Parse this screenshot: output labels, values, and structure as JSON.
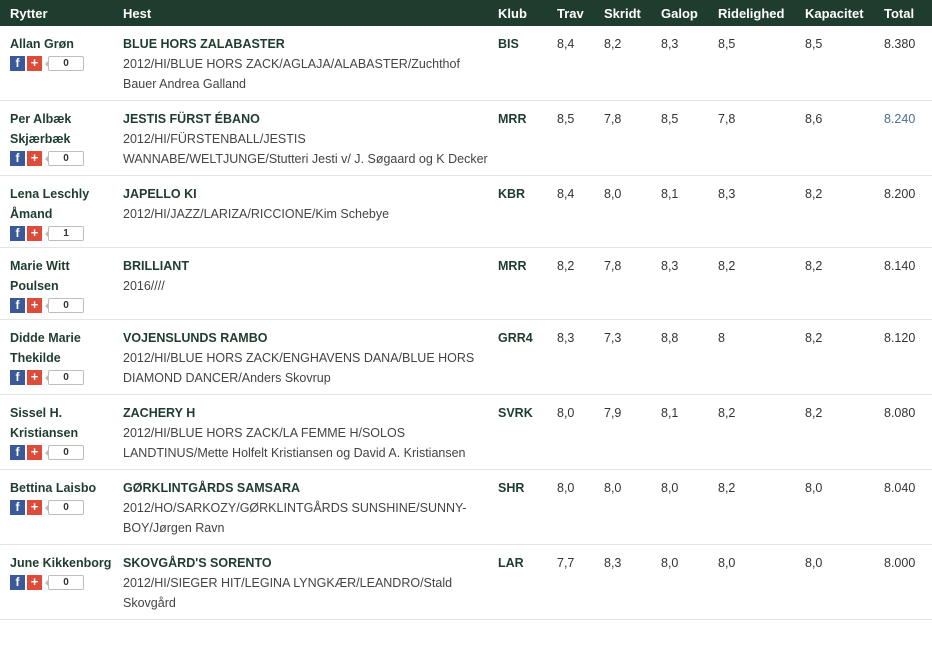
{
  "table": {
    "headers": [
      "Rytter",
      "Hest",
      "Klub",
      "Trav",
      "Skridt",
      "Galop",
      "Ridelighed",
      "Kapacitet",
      "Total"
    ],
    "rows": [
      {
        "rider": "Allan Grøn",
        "horse": "BLUE HORS ZALABASTER",
        "info": "2012/HI/BLUE HORS ZACK/AGLAJA/ALABASTER/Zuchthof Bauer Andrea Galland",
        "club": "BIS",
        "trav": "8,4",
        "skridt": "8,2",
        "galop": "8,3",
        "ridelighed": "8,5",
        "kapacitet": "8,5",
        "total": "8.380",
        "count": "0"
      },
      {
        "rider": "Per Albæk Skjærbæk",
        "horse": "JESTIS FÜRST ÉBANO",
        "info": "2012/HI/FÜRSTENBALL/JESTIS WANNABE/WELTJUNGE/Stutteri Jesti v/ J. Søgaard og K Decker",
        "club": "MRR",
        "trav": "8,5",
        "skridt": "7,8",
        "galop": "8,5",
        "ridelighed": "7,8",
        "kapacitet": "8,6",
        "total": "8.240",
        "count": "0"
      },
      {
        "rider": "Lena Leschly Åmand",
        "horse": "JAPELLO KI",
        "info": "2012/HI/JAZZ/LARIZA/RICCIONE/Kim Schebye",
        "club": "KBR",
        "trav": "8,4",
        "skridt": "8,0",
        "galop": "8,1",
        "ridelighed": "8,3",
        "kapacitet": "8,2",
        "total": "8.200",
        "count": "1"
      },
      {
        "rider": "Marie Witt Poulsen",
        "horse": "BRILLIANT",
        "info": "2016////",
        "club": "MRR",
        "trav": "8,2",
        "skridt": "7,8",
        "galop": "8,3",
        "ridelighed": "8,2",
        "kapacitet": "8,2",
        "total": "8.140",
        "count": "0"
      },
      {
        "rider": "Didde Marie Thekilde",
        "horse": "VOJENSLUNDS RAMBO",
        "info": "2012/HI/BLUE HORS ZACK/ENGHAVENS DANA/BLUE HORS DIAMOND DANCER/Anders Skovrup",
        "club": "GRR4",
        "trav": "8,3",
        "skridt": "7,3",
        "galop": "8,8",
        "ridelighed": "8",
        "kapacitet": "8,2",
        "total": "8.120",
        "count": "0"
      },
      {
        "rider": "Sissel H. Kristiansen",
        "horse": "ZACHERY H",
        "info": "2012/HI/BLUE HORS ZACK/LA FEMME H/SOLOS LANDTINUS/Mette Holfelt Kristiansen og David A. Kristiansen",
        "club": "SVRK",
        "trav": "8,0",
        "skridt": "7,9",
        "galop": "8,1",
        "ridelighed": "8,2",
        "kapacitet": "8,2",
        "total": "8.080",
        "count": "0"
      },
      {
        "rider": "Bettina Laisbo",
        "horse": "GØRKLINTGÅRDS SAMSARA",
        "info": "2012/HO/SARKOZY/GØRKLINTGÅRDS SUNSHINE/SUNNY-BOY/Jørgen Ravn",
        "club": "SHR",
        "trav": "8,0",
        "skridt": "8,0",
        "galop": "8,0",
        "ridelighed": "8,2",
        "kapacitet": "8,0",
        "total": "8.040",
        "count": "0"
      },
      {
        "rider": "June Kikkenborg",
        "horse": "SKOVGÅRD'S SORENTO",
        "info": "2012/HI/SIEGER HIT/LEGINA LYNGKÆR/LEANDRO/Stald Skovgård",
        "club": "LAR",
        "trav": "7,7",
        "skridt": "8,3",
        "galop": "8,0",
        "ridelighed": "8,0",
        "kapacitet": "8,0",
        "total": "8.000",
        "count": "0"
      }
    ]
  },
  "social": {
    "facebook_glyph": "f",
    "google_glyph": "+"
  },
  "colors": {
    "header_bg": "#1f3d2f",
    "accent_text": "#1f3d2f",
    "facebook": "#3b5998",
    "google": "#dd4b39"
  }
}
